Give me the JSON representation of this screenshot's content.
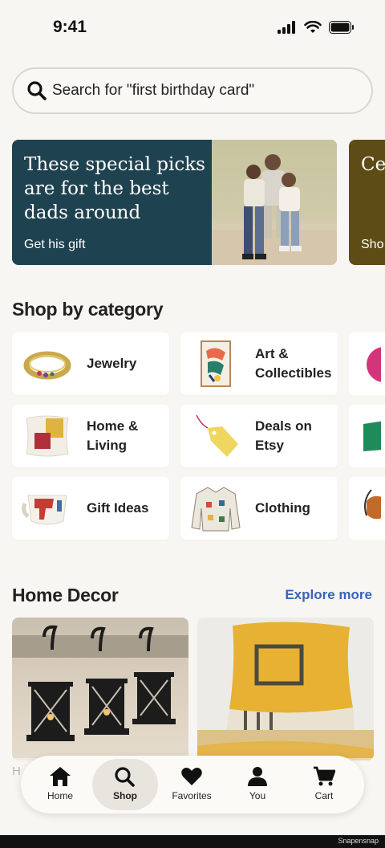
{
  "status_bar": {
    "time": "9:41",
    "icons": [
      "cellular-icon",
      "wifi-icon",
      "battery-icon"
    ]
  },
  "search": {
    "placeholder": "Search for \"first birthday card\"",
    "icon": "search-icon"
  },
  "banners": [
    {
      "title": "These special picks are for the best dads around",
      "cta": "Get his gift",
      "bg": "#1f4250"
    },
    {
      "title": "Ce fav wit",
      "cta": "Sho",
      "bg": "#5e4c17"
    }
  ],
  "categories_section": {
    "title": "Shop by category",
    "items": [
      {
        "label": "Jewelry",
        "icon": "ring-icon"
      },
      {
        "label": "Art & Collectibles",
        "icon": "art-print-icon"
      },
      {
        "label": "Home & Living",
        "icon": "pillow-icon"
      },
      {
        "label": "Deals on Etsy",
        "icon": "price-tag-icon"
      },
      {
        "label": "Gift Ideas",
        "icon": "mug-icon"
      },
      {
        "label": "Clothing",
        "icon": "jacket-icon"
      }
    ]
  },
  "home_decor": {
    "title": "Home Decor",
    "explore_label": "Explore more",
    "under_text": "H"
  },
  "tab_bar": {
    "items": [
      {
        "label": "Home",
        "icon": "home-icon",
        "active": false
      },
      {
        "label": "Shop",
        "icon": "search-icon",
        "active": true
      },
      {
        "label": "Favorites",
        "icon": "heart-icon",
        "active": false
      },
      {
        "label": "You",
        "icon": "person-icon",
        "active": false
      },
      {
        "label": "Cart",
        "icon": "cart-icon",
        "active": false
      }
    ]
  },
  "watermark": "Snapensnap",
  "colors": {
    "background": "#f8f6f2",
    "link": "#3b63b8",
    "banner_dark": "#1f4250"
  }
}
